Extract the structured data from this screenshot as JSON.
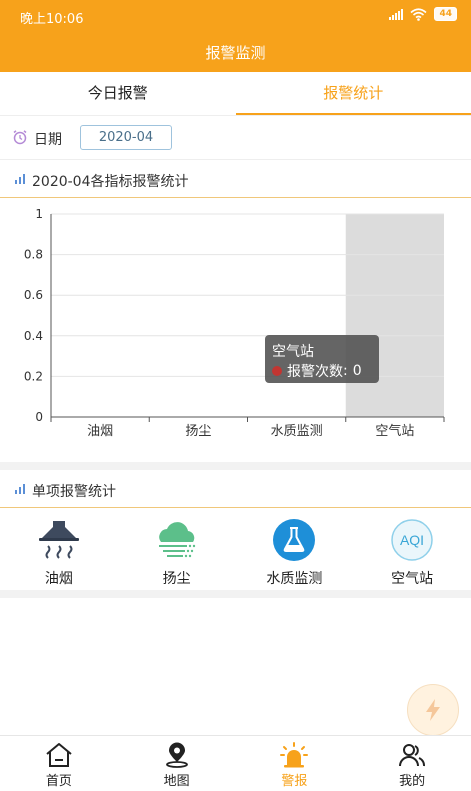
{
  "status_bar": {
    "time": "晚上10:06",
    "battery": "44"
  },
  "header": {
    "title": "报警监测"
  },
  "tabs": [
    {
      "label": "今日报警",
      "active": false
    },
    {
      "label": "报警统计",
      "active": true
    }
  ],
  "date_filter": {
    "label": "日期",
    "value": "2020-04"
  },
  "chart_section": {
    "title": "2020-04各指标报警统计"
  },
  "chart_data": {
    "type": "bar",
    "categories": [
      "油烟",
      "扬尘",
      "水质监测",
      "空气站"
    ],
    "series": [
      {
        "name": "报警次数",
        "values": [
          0,
          0,
          0,
          0
        ]
      }
    ],
    "ylim": [
      0,
      1
    ],
    "yticks": [
      "0",
      "0.2",
      "0.4",
      "0.6",
      "0.8",
      "1"
    ],
    "highlighted_category": "空气站",
    "grid": true
  },
  "tooltip": {
    "title": "空气站",
    "series_name": "报警次数",
    "value": "0"
  },
  "single_section": {
    "title": "单项报警统计",
    "items": [
      {
        "label": "油烟",
        "icon": "range-hood-icon"
      },
      {
        "label": "扬尘",
        "icon": "dust-cloud-icon"
      },
      {
        "label": "水质监测",
        "icon": "flask-icon"
      },
      {
        "label": "空气站",
        "icon": "aqi-icon",
        "icon_text": "AQI"
      }
    ]
  },
  "bottom_nav": [
    {
      "label": "首页",
      "icon": "home-icon",
      "active": false
    },
    {
      "label": "地图",
      "icon": "map-pin-icon",
      "active": false
    },
    {
      "label": "警报",
      "icon": "alarm-icon",
      "active": true
    },
    {
      "label": "我的",
      "icon": "user-icon",
      "active": false
    }
  ],
  "colors": {
    "accent": "#f7a21b",
    "tooltip_dot": "#c23531",
    "highlight_band": "#dcdcdc",
    "flask_blue": "#1e8fd8",
    "dust_green": "#5cbf8a"
  }
}
